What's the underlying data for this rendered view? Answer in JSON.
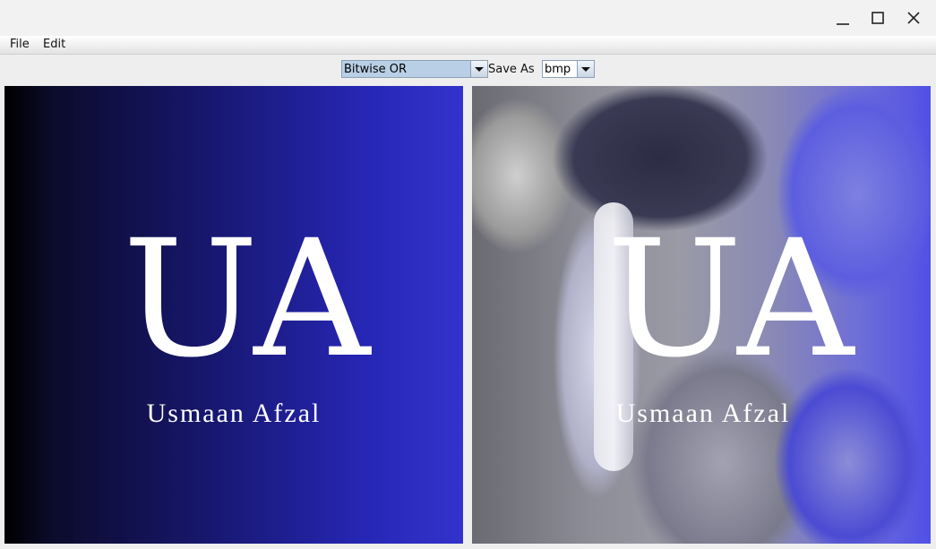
{
  "window": {
    "controls": {
      "minimize_icon": "minimize-icon",
      "maximize_icon": "maximize-icon",
      "close_icon": "close-icon"
    }
  },
  "menubar": {
    "file": "File",
    "edit": "Edit"
  },
  "toolbar": {
    "operation": {
      "selected": "Bitwise OR"
    },
    "save_as_label": "Save As",
    "format": {
      "selected": "bmp"
    }
  },
  "left_image": {
    "monogram": "UA",
    "name": "Usmaan Afzal"
  },
  "right_image": {
    "monogram": "UA",
    "name": "Usmaan Afzal"
  },
  "colors": {
    "accent": "#3333cc",
    "combo_bg": "#b8cfe5",
    "combo_border": "#8e9fb5"
  }
}
